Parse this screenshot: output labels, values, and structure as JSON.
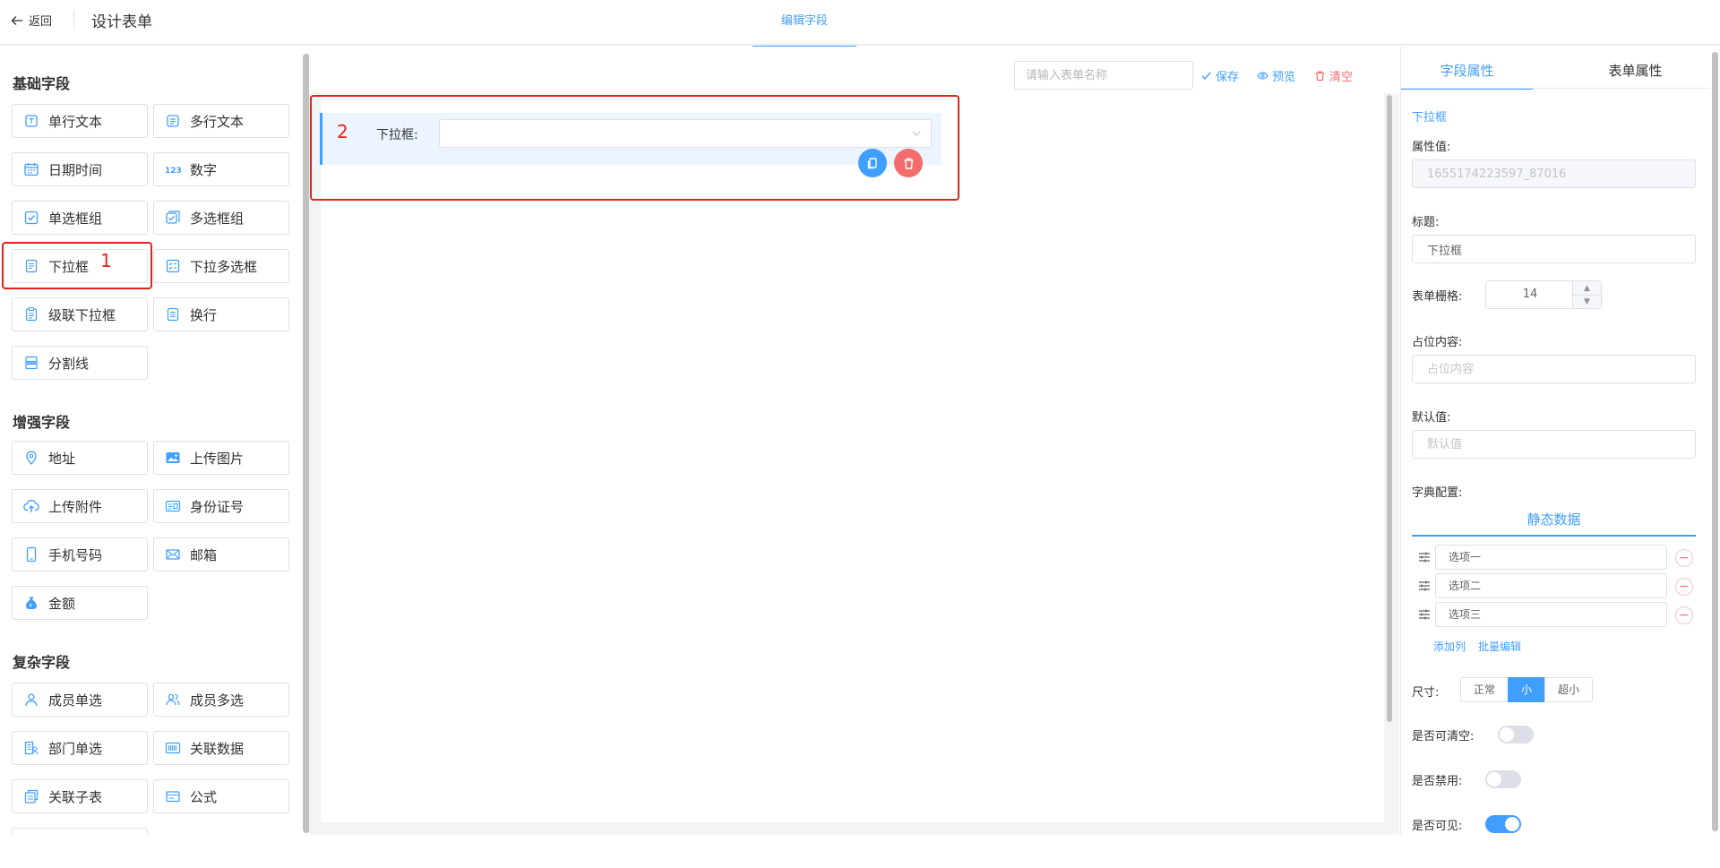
{
  "header": {
    "back_label": "返回",
    "title": "设计表单",
    "active_tab": "编辑字段"
  },
  "sidebar": {
    "groups": [
      {
        "title": "基础字段",
        "items": [
          {
            "label": "单行文本",
            "icon": "text-line-icon"
          },
          {
            "label": "多行文本",
            "icon": "text-multi-icon"
          },
          {
            "label": "日期时间",
            "icon": "calendar-icon"
          },
          {
            "label": "数字",
            "icon": "number-icon"
          },
          {
            "label": "单选框组",
            "icon": "radio-check-icon"
          },
          {
            "label": "多选框组",
            "icon": "checkbox-group-icon"
          },
          {
            "label": "下拉框",
            "icon": "select-icon"
          },
          {
            "label": "下拉多选框",
            "icon": "multi-select-icon"
          },
          {
            "label": "级联下拉框",
            "icon": "cascader-icon"
          },
          {
            "label": "换行",
            "icon": "line-break-icon"
          },
          {
            "label": "分割线",
            "icon": "divider-icon"
          }
        ]
      },
      {
        "title": "增强字段",
        "items": [
          {
            "label": "地址",
            "icon": "location-icon"
          },
          {
            "label": "上传图片",
            "icon": "image-icon"
          },
          {
            "label": "上传附件",
            "icon": "upload-icon"
          },
          {
            "label": "身份证号",
            "icon": "id-card-icon"
          },
          {
            "label": "手机号码",
            "icon": "phone-icon"
          },
          {
            "label": "邮箱",
            "icon": "mail-icon"
          },
          {
            "label": "金额",
            "icon": "money-bag-icon"
          }
        ]
      },
      {
        "title": "复杂字段",
        "items": [
          {
            "label": "成员单选",
            "icon": "user-icon"
          },
          {
            "label": "成员多选",
            "icon": "users-icon"
          },
          {
            "label": "部门单选",
            "icon": "department-icon"
          },
          {
            "label": "关联数据",
            "icon": "barcode-icon"
          },
          {
            "label": "关联子表",
            "icon": "subtable-icon"
          },
          {
            "label": "公式",
            "icon": "formula-icon"
          }
        ]
      }
    ]
  },
  "annotations": {
    "one": "1",
    "two": "2"
  },
  "canvas": {
    "form_name_placeholder": "请输入表单名称",
    "save_label": "保存",
    "preview_label": "预览",
    "clear_label": "清空",
    "field_label": "下拉框:"
  },
  "right_panel": {
    "tabs": [
      "字段属性",
      "表单属性"
    ],
    "field_type": "下拉框",
    "attr_value_label": "属性值:",
    "attr_value": "1655174223597_87016",
    "title_label": "标题:",
    "title_value": "下拉框",
    "grid_label": "表单栅格:",
    "grid_value": "14",
    "placeholder_label": "占位内容:",
    "placeholder_value": "占位内容",
    "default_label": "默认值:",
    "default_value": "默认值",
    "dict_label": "字典配置:",
    "dict_tab": "静态数据",
    "options": [
      "选项一",
      "选项二",
      "选项三"
    ],
    "add_column": "添加列",
    "batch_edit": "批量编辑",
    "size_label": "尺寸:",
    "sizes": [
      "正常",
      "小",
      "超小"
    ],
    "active_size": "小",
    "clearable_label": "是否可清空:",
    "clearable": false,
    "disabled_label": "是否禁用:",
    "disabled": false,
    "visible_label": "是否可见:",
    "visible": true
  },
  "colors": {
    "accent": "#409eff",
    "danger": "#f56c6c",
    "annotation": "#e5231b"
  }
}
